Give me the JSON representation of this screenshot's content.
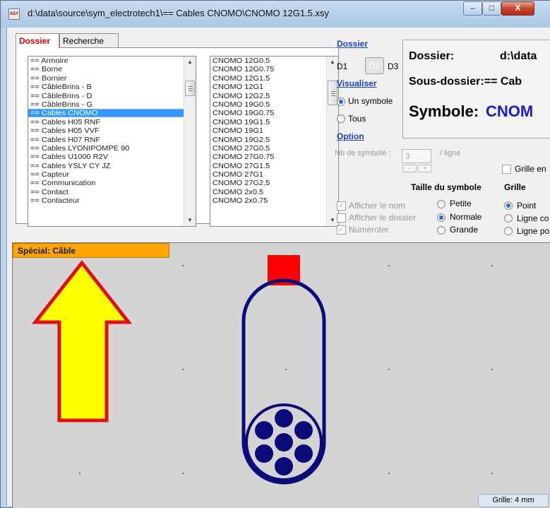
{
  "window": {
    "title": "d:\\data\\source\\sym_electrotech1\\== Cables CNOMO\\CNOMO 12G1.5.xsy",
    "icon_label": "XSY",
    "controls": {
      "minimize": "–",
      "maximize": "□",
      "close": "X"
    }
  },
  "tabs": [
    {
      "label": "Dossier",
      "active": true
    },
    {
      "label": "Recherche",
      "active": false
    }
  ],
  "folders": [
    "== Armoire",
    "== Borne",
    "== Bornier",
    "== CâbleBrins - B",
    "== CâbleBrins - D",
    "== CâbleBrins - G",
    "== Cables CNOMO",
    "== Cables H05 RNF",
    "== Cables H05 VVF",
    "== Cables H07 RNF",
    "== Cables LYONIPOMPE 90",
    "== Cables U1000 R2V",
    "== Cables YSLY CY JZ",
    "== Capteur",
    "== Communication",
    "== Contact",
    "== Contacteur"
  ],
  "folders_selected": 6,
  "symbols": [
    "CNOMO 12G0.5",
    "CNOMO 12G0.75",
    "CNOMO 12G1.5",
    "CNOMO 12G1",
    "CNOMO 12G2.5",
    "CNOMO 19G0.5",
    "CNOMO 19G0.75",
    "CNOMO 19G1.5",
    "CNOMO 19G1",
    "CNOMO 19G2.5",
    "CNOMO 27G0.5",
    "CNOMO 27G0.75",
    "CNOMO 27G1.5",
    "CNOMO 27G1",
    "CNOMO 27G2.5",
    "CNOMO 2x0.5",
    "CNOMO 2x0.75"
  ],
  "dossier_section": {
    "heading": "Dossier",
    "d1": "D1",
    "d2": "D2",
    "d3": "D3"
  },
  "visualiser": {
    "heading": "Visualiser",
    "options": [
      {
        "label": "Un symbole",
        "selected": true
      },
      {
        "label": "Tous",
        "selected": false
      }
    ]
  },
  "option": {
    "heading": "Option",
    "nb_symbole_label": "Nb de symbole :",
    "nb_symbole_value": "3",
    "per_line": "/ ligne",
    "spin_minus": "-",
    "spin_plus": "+"
  },
  "grille_en": "Grille en",
  "checkboxes": [
    {
      "label": "Afficher le nom",
      "checked": true
    },
    {
      "label": "Afficher le dossier",
      "checked": false
    },
    {
      "label": "Numéroter",
      "checked": true
    }
  ],
  "taille": {
    "heading": "Taille du symbole",
    "options": [
      {
        "label": "Petite",
        "selected": false
      },
      {
        "label": "Normale",
        "selected": true
      },
      {
        "label": "Grande",
        "selected": false
      }
    ]
  },
  "grille": {
    "heading": "Grille",
    "options": [
      {
        "label": "Point",
        "selected": true
      },
      {
        "label": "Ligne co",
        "selected": false
      },
      {
        "label": "Ligne po",
        "selected": false
      }
    ]
  },
  "info": {
    "dossier_label": "Dossier:",
    "dossier_value": "d:\\data",
    "sous_dossier": "Sous-dossier:== Cab",
    "symbole_label": "Symbole:",
    "symbole_value": "CNOM"
  },
  "canvas": {
    "special_label": "Spécial: Câble",
    "grid_status": "Grille: 4 mm"
  },
  "colors": {
    "selection": "#3399ff",
    "link": "#1f3fb8",
    "special_bg": "#ffa500",
    "symbol_stroke": "#0b0b7a",
    "connector": "#ff0000",
    "arrow_fill": "#ffff00",
    "arrow_stroke": "#e01010"
  }
}
